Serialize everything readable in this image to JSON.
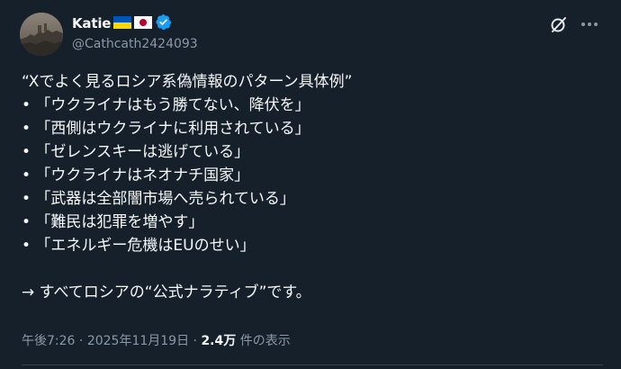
{
  "author": {
    "display_name": "Katie",
    "handle": "@Cathcath2424093",
    "flags": [
      "ukraine-flag",
      "japan-flag"
    ],
    "verified_badge": "verified-badge-icon",
    "colors": {
      "verified": "#1d9bf0",
      "ukraine_blue": "#0057b7",
      "ukraine_yellow": "#ffd700",
      "japan_red": "#bc002d"
    }
  },
  "header_actions": {
    "grok_icon": "grok-icon",
    "more_icon": "more-icon"
  },
  "post": {
    "lines": [
      "“Xでよく見るロシア系偽情報のパターン具体例”",
      "• 「ウクライナはもう勝てない、降伏を」",
      "• 「西側はウクライナに利用されている」",
      "• 「ゼレンスキーは逃げている」",
      "• 「ウクライナはネオナチ国家」",
      "• 「武器は全部闇市場へ売られている」",
      "• 「難民は犯罪を増やす」",
      "• 「エネルギー危機はEUのせい」"
    ],
    "closing": "→ すべてロシアの“公式ナラティブ”です。"
  },
  "meta": {
    "time": "午後7:26",
    "separator1": " · ",
    "date": "2025年11月19日",
    "separator2": " · ",
    "views_count": "2.4万",
    "views_label": " 件の表示"
  },
  "theme": {
    "background": "#15202b",
    "text": "#f7f9f9",
    "secondary_text": "#8b98a5",
    "border": "#38444d"
  }
}
